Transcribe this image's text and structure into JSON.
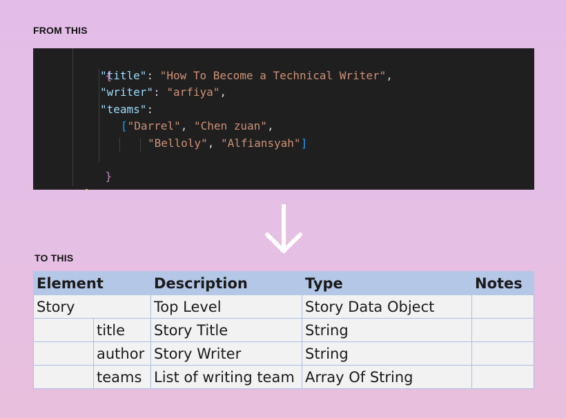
{
  "labels": {
    "from": "FROM THIS",
    "to": "TO THIS"
  },
  "code": {
    "open_outer": "{",
    "open_inner": "{",
    "title_key": "\"title\"",
    "title_value": "\"How To Become a Technical Writer\"",
    "writer_key": "\"writer\"",
    "writer_value": "\"arfiya\"",
    "teams_key": "\"teams\"",
    "team_1": "\"Darrel\"",
    "team_2": "\"Chen zuan\"",
    "team_3": "\"Belloly\"",
    "team_4": "\"Alfiansyah\"",
    "close_inner": "}",
    "close_outer": "}"
  },
  "table": {
    "headers": [
      "Element",
      "Description",
      "Type",
      "Notes"
    ],
    "rows": [
      {
        "element": "Story",
        "child": "",
        "description": "Top Level",
        "type": "Story Data Object",
        "notes": ""
      },
      {
        "element": "",
        "child": "title",
        "description": "Story Title",
        "type": "String",
        "notes": ""
      },
      {
        "element": "",
        "child": "author",
        "description": "Story Writer",
        "type": "String",
        "notes": ""
      },
      {
        "element": "",
        "child": "teams",
        "description": "List of writing team",
        "type": "Array Of String",
        "notes": ""
      }
    ]
  },
  "icons": {
    "arrow": "arrow-down-icon"
  },
  "colors": {
    "background": "#e4bee6",
    "code_background": "#1f1f1f",
    "json_key": "#9cdcfe",
    "json_string": "#ce9178",
    "header_fill": "#b4c7e7",
    "cell_fill": "#f2f2f2"
  }
}
